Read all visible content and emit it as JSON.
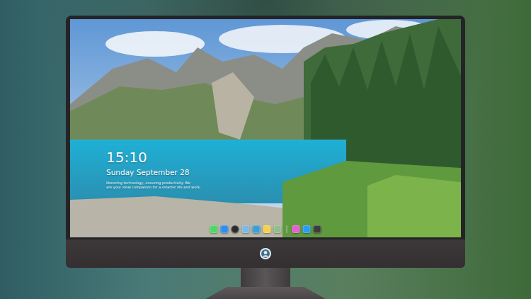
{
  "lock_screen": {
    "time": "15:10",
    "date": "Sunday September 28",
    "caption_lines": [
      "Honoring technology, ensuring productivity. We",
      "are your ideal companion for a smarter life and work."
    ]
  },
  "dock": {
    "items": [
      {
        "kind": "app",
        "color": "#4cd964"
      },
      {
        "kind": "app",
        "color": "#2f8cf0"
      },
      {
        "kind": "round",
        "color": "#2b2b2b"
      },
      {
        "kind": "app",
        "color": "#7fb8e0"
      },
      {
        "kind": "app",
        "color": "#3a9fd8"
      },
      {
        "kind": "app",
        "color": "#f5d24a"
      },
      {
        "kind": "app",
        "color": "#8fbf8a"
      },
      {
        "kind": "separator",
        "color": "#d8d8d8"
      },
      {
        "kind": "app",
        "color": "#e65fd0"
      },
      {
        "kind": "app",
        "color": "#2a9df4"
      },
      {
        "kind": "app",
        "color": "#3c3c3c"
      }
    ]
  }
}
